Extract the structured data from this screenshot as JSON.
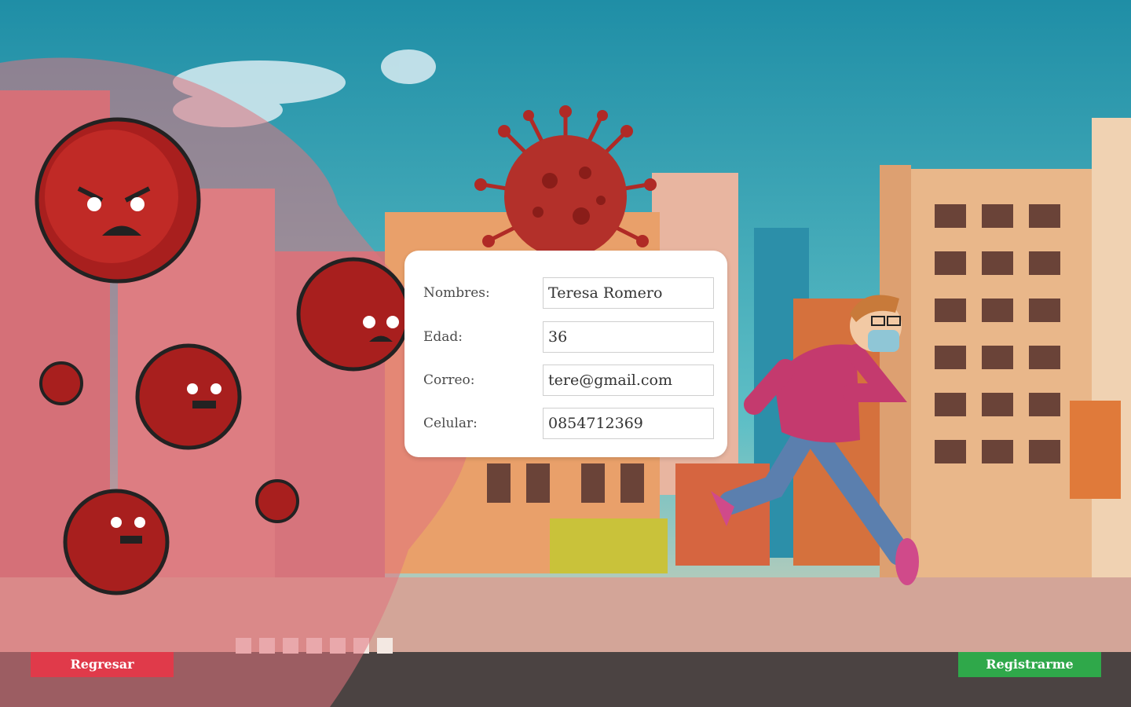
{
  "form": {
    "fields": [
      {
        "label": "Nombres:",
        "value": "Teresa Romero"
      },
      {
        "label": "Edad:",
        "value": "36"
      },
      {
        "label": "Correo:",
        "value": "tere@gmail.com"
      },
      {
        "label": "Celular:",
        "value": "0854712369"
      }
    ]
  },
  "buttons": {
    "back_label": "Regresar",
    "register_label": "Registrarme"
  },
  "colors": {
    "back_button": "#e03a4a",
    "register_button": "#2fa84a",
    "virus": "#a8201f",
    "sky": "#2a9bb0"
  },
  "scene": {
    "icons": [
      "virus-icon",
      "running-person-icon",
      "city-buildings"
    ]
  }
}
